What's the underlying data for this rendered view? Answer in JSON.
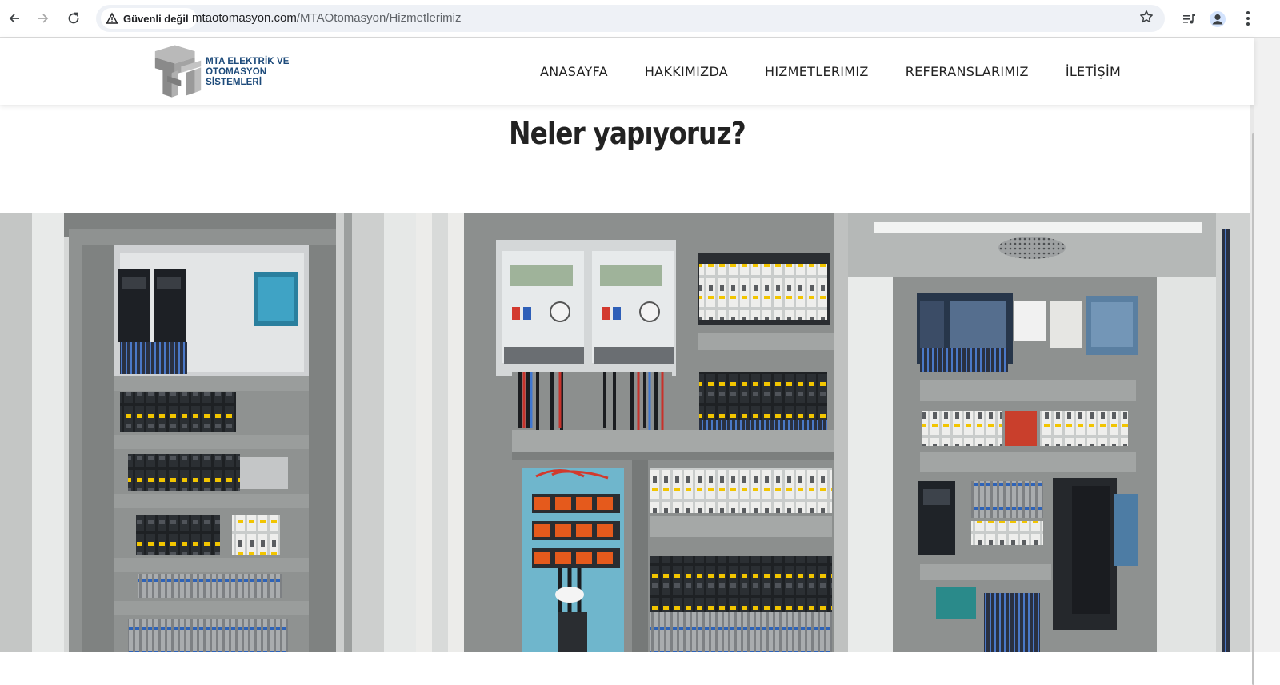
{
  "browser": {
    "security_label": "Güvenli değil",
    "url_host": "mtaotomasyon.com",
    "url_path": "/MTAOtomasyon/Hizmetlerimiz",
    "icons": [
      "back-icon",
      "forward-icon",
      "reload-icon",
      "warning-icon",
      "star-icon",
      "media-icon",
      "profile-icon",
      "menu-icon"
    ]
  },
  "site": {
    "logo_line1": "MTA ELEKTRİK VE",
    "logo_line2": "OTOMASYON SİSTEMLERİ",
    "nav": [
      {
        "label": "ANASAYFA"
      },
      {
        "label": "HAKKIMIZDA"
      },
      {
        "label": "HIZMETLERIMIZ"
      },
      {
        "label": "REFERANSLARIMIZ"
      },
      {
        "label": "İLETİŞİM"
      }
    ],
    "title": "Neler yapıyoruz?"
  },
  "colors": {
    "logo_blue": "#1c4a7a",
    "logo_gray": "#9a9a9a",
    "panel_gray": "#8f9291",
    "cabinet_white": "#e4e6e5",
    "text_dark": "#222222"
  }
}
